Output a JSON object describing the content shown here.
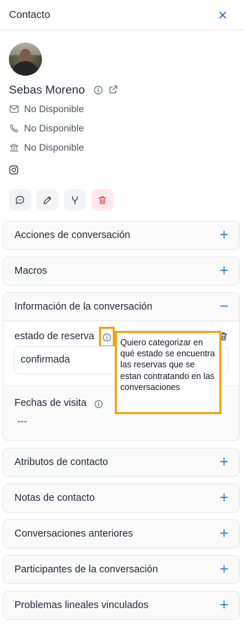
{
  "header": {
    "title": "Contacto"
  },
  "contact": {
    "name": "Sebas Moreno",
    "email": "No Disponible",
    "phone": "No Disponible",
    "company": "No Disponible"
  },
  "sections": {
    "acciones": "Acciones de conversación",
    "macros": "Macros",
    "informacion": "Información de la conversación",
    "atributos_contacto": "Atributos de contacto",
    "notas": "Notas de contacto",
    "anteriores": "Conversaciones anteriores",
    "participantes": "Participantes de la conversación",
    "problemas": "Problemas lineales vinculados"
  },
  "attributes": {
    "estado_label": "estado de reserva",
    "estado_value": "confirmada",
    "fechas_label": "Fechas de visita",
    "fechas_value": "---"
  },
  "tooltip": {
    "text": "Quiero categorizar en qué estado se encuentra las reservas que se estan contratando en las conversaciones"
  },
  "icons": [
    "close-icon",
    "info-icon",
    "external-link-icon",
    "mail-icon",
    "phone-icon",
    "bank-icon",
    "instagram-icon",
    "chat-icon",
    "edit-icon",
    "merge-icon",
    "trash-icon",
    "plus-icon",
    "minus-icon"
  ],
  "colors": {
    "accent": "#1f6feb",
    "danger": "#e5484d",
    "highlight": "#f5a30a"
  }
}
